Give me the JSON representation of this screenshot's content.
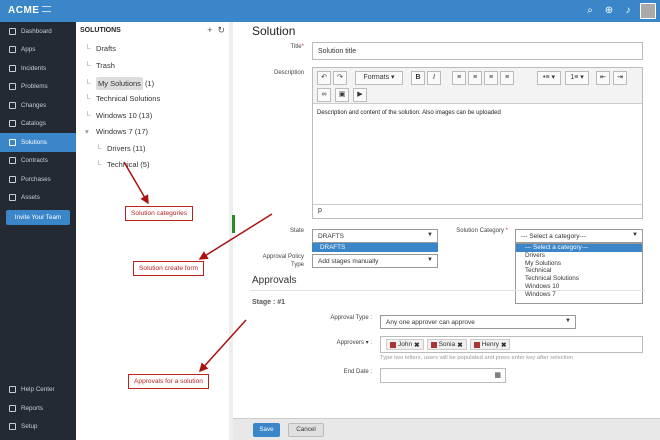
{
  "app": {
    "brand": "ACME"
  },
  "sidebar": {
    "items": [
      {
        "label": "Dashboard",
        "icon": "dashboard-icon"
      },
      {
        "label": "Apps",
        "icon": "apps-icon"
      },
      {
        "label": "Incidents",
        "icon": "incidents-icon"
      },
      {
        "label": "Problems",
        "icon": "problems-icon"
      },
      {
        "label": "Changes",
        "icon": "changes-icon"
      },
      {
        "label": "Catalogs",
        "icon": "catalogs-icon"
      },
      {
        "label": "Solutions",
        "icon": "solutions-icon"
      },
      {
        "label": "Contracts",
        "icon": "contracts-icon"
      },
      {
        "label": "Purchases",
        "icon": "purchases-icon"
      },
      {
        "label": "Assets",
        "icon": "assets-icon"
      }
    ],
    "invite": "Invite Your Team",
    "bottom": [
      {
        "label": "Help Center",
        "icon": "help-icon"
      },
      {
        "label": "Reports",
        "icon": "reports-icon"
      },
      {
        "label": "Setup",
        "icon": "setup-icon"
      }
    ],
    "active": "Solutions",
    "accent": "#3a86c8"
  },
  "tree": {
    "title": "SOLUTIONS",
    "nodes": [
      {
        "label": "Drafts",
        "count": ""
      },
      {
        "label": "Trash",
        "count": ""
      },
      {
        "label": "My Solutions",
        "count": "(1)"
      },
      {
        "label": "Technical Solutions",
        "count": ""
      },
      {
        "label": "Windows 10",
        "count": "(13)"
      },
      {
        "label": "Windows 7",
        "count": "(17)"
      },
      {
        "label": "Drivers",
        "count": "(11)"
      },
      {
        "label": "Technical",
        "count": "(5)"
      }
    ]
  },
  "form": {
    "page_title": "Solution",
    "title_label": "Title",
    "title_value": "Solution title",
    "description_label": "Description",
    "toolbar": {
      "formats": "Formats"
    },
    "description_value": "Description and content of the solution. Also images can be uploaded",
    "editor_status": "p",
    "state_label": "State",
    "state_value": "DRAFTS",
    "state_option_highlight": "DRAFTS",
    "category_label": "Solution Category",
    "category_value": "--- Select a category---",
    "category_options": [
      "--- Select a category---",
      "Drivers",
      "My Solutions",
      "Technical",
      "Technical Solutions",
      "Windows 10",
      "Windows 7"
    ],
    "approval_policy_label_1": "Approval Policy",
    "approval_policy_label_2": "Type",
    "approval_policy_value": "Add stages manually",
    "approvals_heading": "Approvals",
    "stage_label": "Stage : #1",
    "approval_type_label": "Approval Type :",
    "approval_type_value": "Any one approver can approve",
    "approvers_label": "Approvers",
    "approvers": [
      "John",
      "Sonia",
      "Henry"
    ],
    "approvers_hint": "Type two letters, users will be populated and press enter key after selection",
    "end_date_label": "End Date :"
  },
  "footer": {
    "save": "Save",
    "cancel": "Cancel"
  },
  "callouts": {
    "categories": "Solution categories",
    "create_form": "Solution create form",
    "approvals": "Approvals for a solution"
  }
}
